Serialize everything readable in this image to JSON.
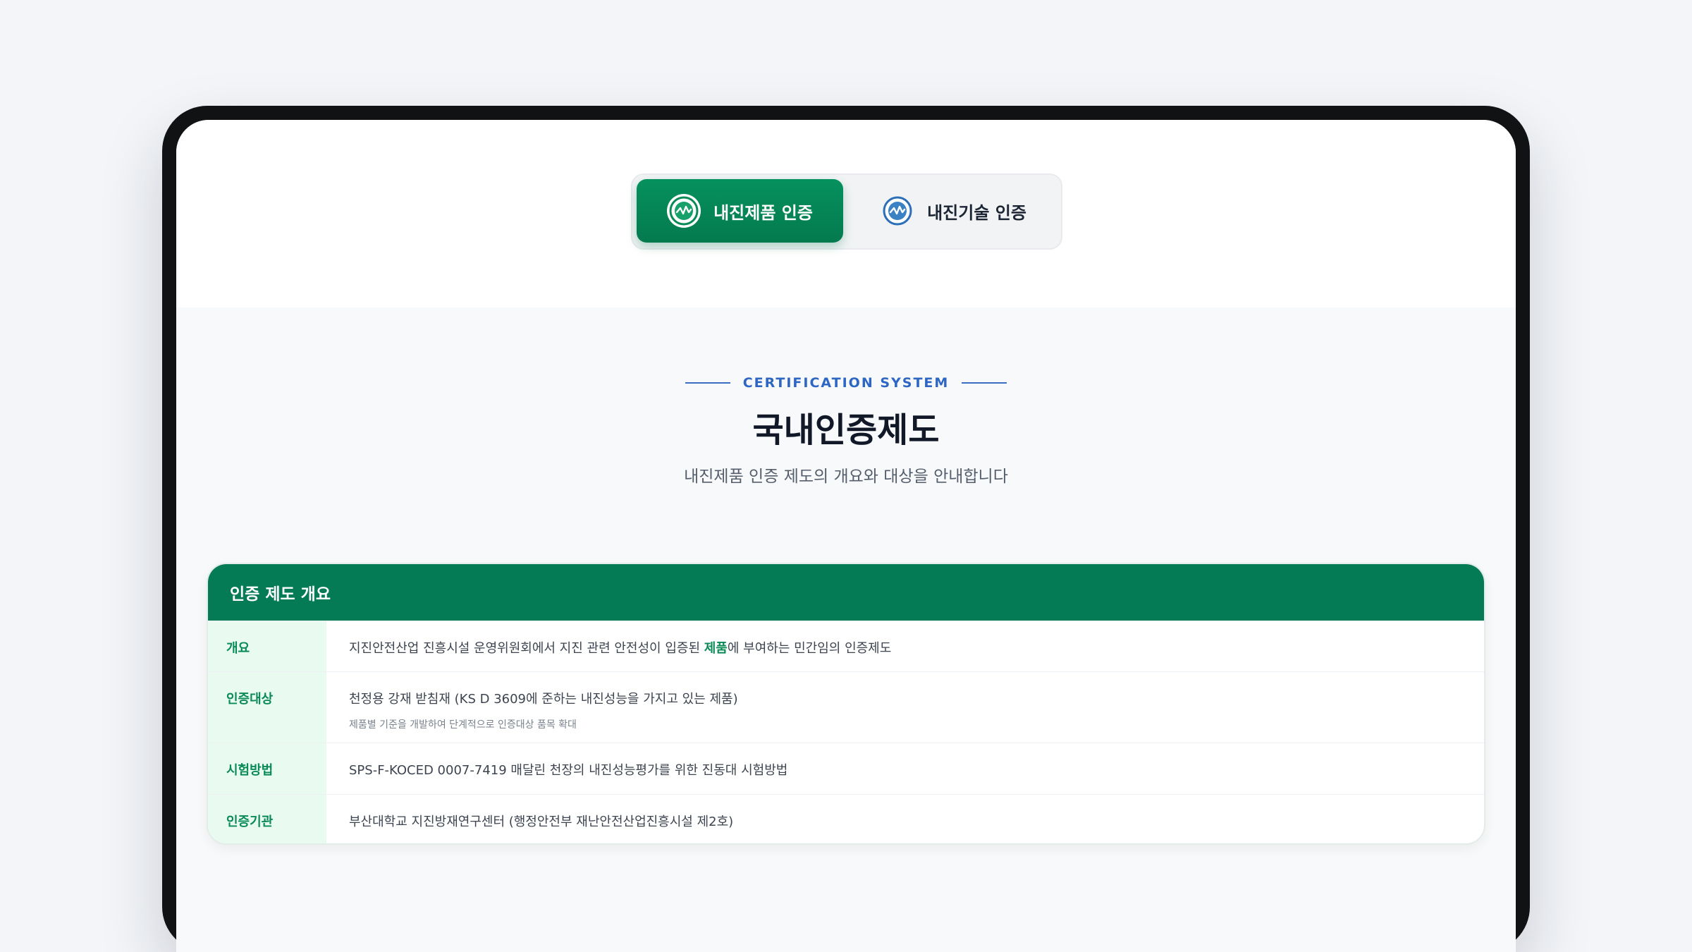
{
  "tabs": [
    {
      "label": "내진제품 인증",
      "active": true,
      "icon": "seismic-product-badge-icon"
    },
    {
      "label": "내진기술 인증",
      "active": false,
      "icon": "seismic-technology-badge-icon"
    }
  ],
  "header": {
    "eyebrow": "CERTIFICATION SYSTEM",
    "title": "국내인증제도",
    "subtitle": "내진제품 인증 제도의 개요와 대상을 안내합니다"
  },
  "card": {
    "title": "인증 제도 개요",
    "rows": [
      {
        "label": "개요",
        "value_before": "지진안전산업 진흥시설 운영위원회에서 지진 관련 안전성이 입증된 ",
        "value_highlight": "제품",
        "value_after": "에 부여하는 민간임의 인증제도"
      },
      {
        "label": "인증대상",
        "value": "천정용 강재 받침재 (KS D 3609에 준하는 내진성능을 가지고 있는 제품)",
        "note": "제품별 기준을 개발하여 단계적으로 인증대상 품목 확대"
      },
      {
        "label": "시험방법",
        "value": "SPS-F-KOCED 0007-7419 매달린 천장의 내진성능평가를 위한 진동대 시험방법"
      },
      {
        "label": "인증기관",
        "value": "부산대학교 지진방재연구센터 (행정안전부 재난안전산업진흥시설 제2호)"
      }
    ]
  },
  "colors": {
    "accent_green": "#047a55",
    "eyebrow_blue": "#2d66c3",
    "label_bg": "#e9fbf1"
  }
}
